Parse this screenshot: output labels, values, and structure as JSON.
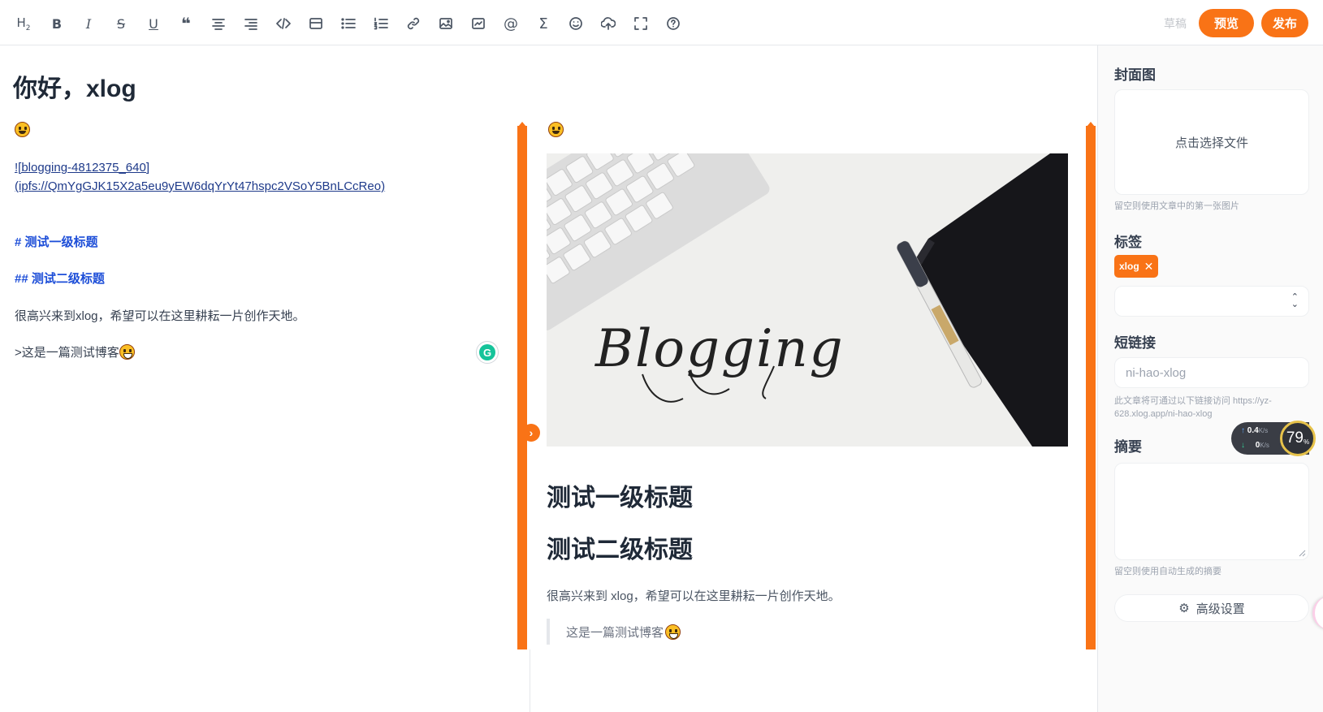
{
  "toolbar": {
    "tools": [
      {
        "name": "heading-icon",
        "glyph": "H₂"
      },
      {
        "name": "bold-icon",
        "glyph": "B"
      },
      {
        "name": "italic-icon",
        "glyph": "I"
      },
      {
        "name": "strikethrough-icon",
        "glyph": "S"
      },
      {
        "name": "underline-icon",
        "glyph": "U"
      },
      {
        "name": "quote-icon",
        "glyph": "❝"
      },
      {
        "name": "align-center-icon"
      },
      {
        "name": "align-right-icon"
      },
      {
        "name": "code-icon"
      },
      {
        "name": "code-block-icon"
      },
      {
        "name": "bullet-list-icon"
      },
      {
        "name": "ordered-list-icon"
      },
      {
        "name": "link-icon"
      },
      {
        "name": "image-icon"
      },
      {
        "name": "embed-icon"
      },
      {
        "name": "mention-icon",
        "glyph": "@"
      },
      {
        "name": "math-icon",
        "glyph": "Σ"
      },
      {
        "name": "emoji-icon"
      },
      {
        "name": "upload-icon"
      },
      {
        "name": "fullscreen-icon"
      },
      {
        "name": "help-icon",
        "glyph": "?"
      }
    ],
    "draft_label": "草稿",
    "preview_label": "预览",
    "publish_label": "发布"
  },
  "editor": {
    "title": "你好，xlog",
    "markdown": {
      "emoji_line": "😀",
      "image_line_1": "![blogging-4812375_640]",
      "image_line_2": "(ipfs://QmYgGJK15X2a5eu9yEW6dqYrYt47hspc2VSoY5BnLCcReo)",
      "h1_line": "# 测试一级标题",
      "h2_line": "## 测试二级标题",
      "paragraph": "很高兴来到xlog，希望可以在这里耕耘一片创作天地。",
      "quote": ">这是一篇测试博客"
    }
  },
  "preview": {
    "image_text": "Blogging",
    "h1": "测试一级标题",
    "h2": "测试二级标题",
    "paragraph": "很高兴来到 xlog，希望可以在这里耕耘一片创作天地。",
    "quote": "这是一篇测试博客"
  },
  "sidebar": {
    "cover_label": "封面图",
    "cover_placeholder": "点击选择文件",
    "cover_hint": "留空则使用文章中的第一张图片",
    "tags_label": "标签",
    "tag": "xlog",
    "tag_select_value": "",
    "slug_label": "短链接",
    "slug_placeholder": "ni-hao-xlog",
    "slug_hint_1": "此文章将可通过以下链接访问 https://yz-",
    "slug_hint_2": "628.xlog.app/ni-hao-xlog",
    "excerpt_label": "摘要",
    "excerpt_hint": "留空则使用自动生成的摘要",
    "advanced_label": "高级设置"
  },
  "network_widget": {
    "upload": "0.4",
    "download": "0",
    "unit": "K/s",
    "percent": "79",
    "percent_unit": "%"
  },
  "colors": {
    "accent": "#f97316",
    "heading_link": "#1d4ed8",
    "link": "#1e3a8a"
  }
}
